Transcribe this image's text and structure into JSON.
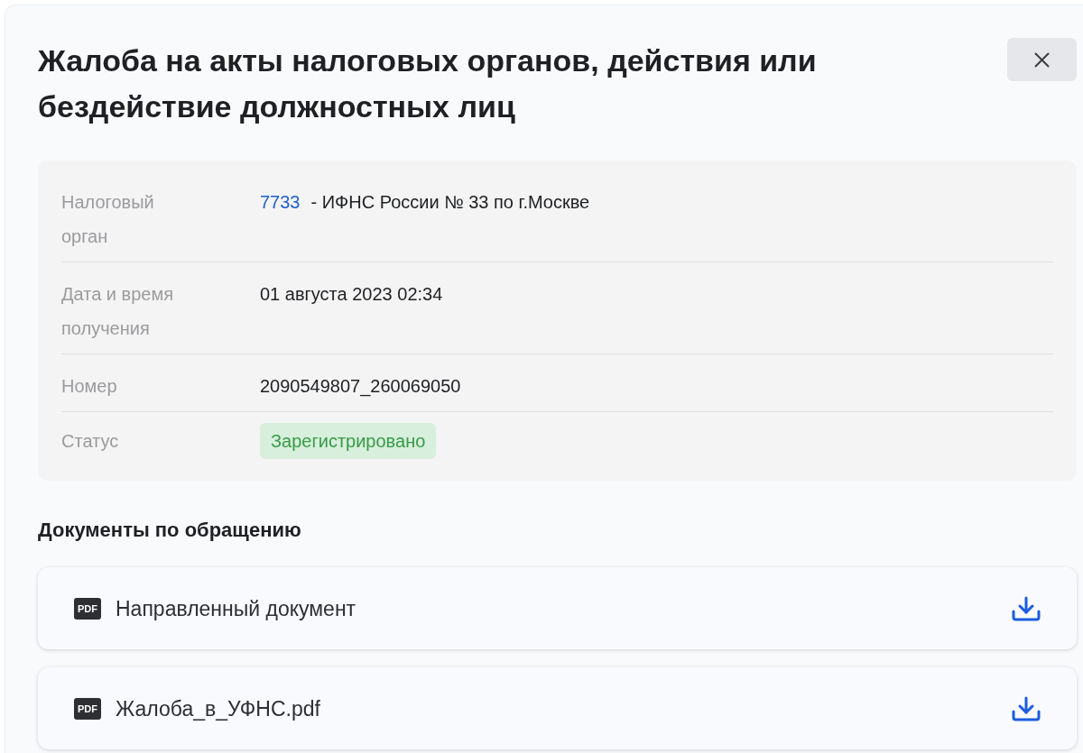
{
  "dialog": {
    "title": "Жалоба на акты налоговых органов, действия или бездействие должностных лиц"
  },
  "details": [
    {
      "kind": "link",
      "label": "Налоговый орган",
      "link": "7733",
      "value": "- ИФНС России № 33 по г.Москве"
    },
    {
      "kind": "text",
      "label": "Дата и время получения",
      "value": "01 августа 2023 02:34"
    },
    {
      "kind": "text",
      "label": "Номер",
      "value": "2090549807_260069050"
    },
    {
      "kind": "status",
      "label": "Статус",
      "value": "Зарегистрировано"
    }
  ],
  "documents": {
    "title": "Документы по обращению",
    "items": [
      {
        "file_type": "PDF",
        "name": "Направленный документ"
      },
      {
        "file_type": "PDF",
        "name": "Жалоба_в_УФНС.pdf"
      }
    ]
  }
}
